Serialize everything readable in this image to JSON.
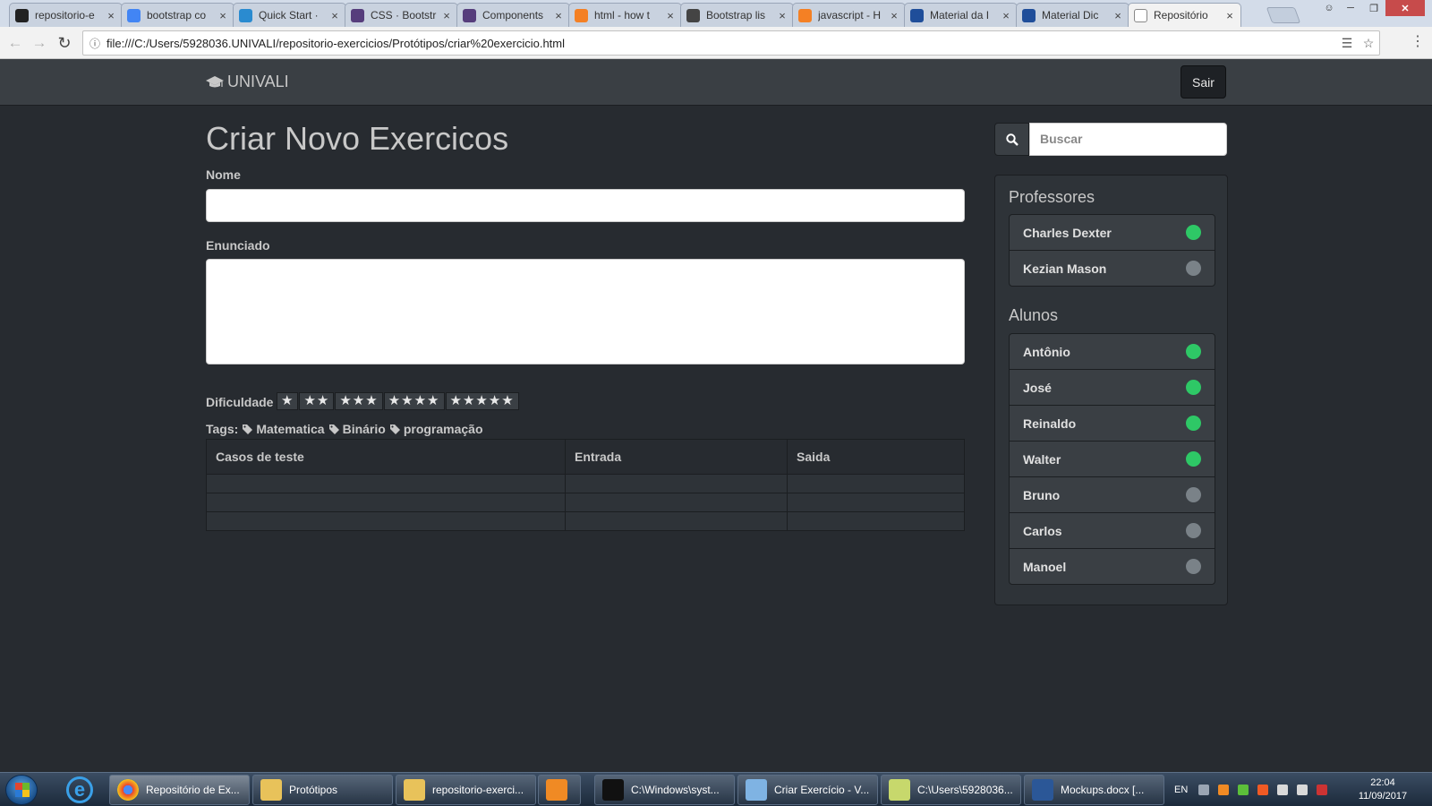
{
  "browser": {
    "tabs": [
      {
        "label": "repositorio-e",
        "icon": "github-icon",
        "color": "#222222"
      },
      {
        "label": "bootstrap co",
        "icon": "google-icon",
        "color": "#4285f4"
      },
      {
        "label": "Quick Start ·",
        "icon": "bootstrap-icon",
        "color": "#2a8bd0"
      },
      {
        "label": "CSS · Bootstr",
        "icon": "bootstrap-icon",
        "color": "#563d7c"
      },
      {
        "label": "Components",
        "icon": "bootstrap-icon",
        "color": "#563d7c"
      },
      {
        "label": "html - how t",
        "icon": "stackoverflow-icon",
        "color": "#f48024"
      },
      {
        "label": "Bootstrap lis",
        "icon": "bootstrap-icon",
        "color": "#444444"
      },
      {
        "label": "javascript - H",
        "icon": "stackoverflow-icon",
        "color": "#f48024"
      },
      {
        "label": "Material da I",
        "icon": "univali-icon",
        "color": "#1f4e9a"
      },
      {
        "label": "Material Dic",
        "icon": "univali-icon",
        "color": "#1f4e9a"
      },
      {
        "label": "Repositório",
        "icon": "page-icon",
        "color": "#ffffff"
      }
    ],
    "url": "file:///C:/Users/5928036.UNIVALI/repositorio-exercicios/Protótipos/criar%20exercicio.html"
  },
  "navbar": {
    "brand": "UNIVALI",
    "logout": "Sair"
  },
  "form": {
    "title": "Criar Novo Exercicos",
    "name_label": "Nome",
    "statement_label": "Enunciado",
    "difficulty_label": "Dificuldade",
    "difficulty_options": [
      "★",
      "★★",
      "★★★",
      "★★★★",
      "★★★★★"
    ],
    "tags_label": "Tags:",
    "tags": [
      "Matematica",
      "Binário",
      "programação"
    ],
    "table": {
      "headers": [
        "Casos de teste",
        "Entrada",
        "Saida"
      ],
      "rows": [
        [
          "",
          "",
          ""
        ],
        [
          "",
          "",
          ""
        ],
        [
          "",
          "",
          ""
        ]
      ]
    }
  },
  "sidebar": {
    "search_placeholder": "Buscar",
    "professors_title": "Professores",
    "professors": [
      {
        "name": "Charles Dexter",
        "online": true
      },
      {
        "name": "Kezian Mason",
        "online": false
      }
    ],
    "students_title": "Alunos",
    "students": [
      {
        "name": "Antônio",
        "online": true
      },
      {
        "name": "José",
        "online": true
      },
      {
        "name": "Reinaldo",
        "online": true
      },
      {
        "name": "Walter",
        "online": true
      },
      {
        "name": "Bruno",
        "online": false
      },
      {
        "name": "Carlos",
        "online": false
      },
      {
        "name": "Manoel",
        "online": false
      }
    ],
    "online_color": "#2ec866",
    "offline_color": "#7a8288"
  },
  "taskbar": {
    "items": [
      {
        "label": "Repositório de Ex...",
        "icon": "chrome-icon",
        "active": true
      },
      {
        "label": "Protótipos",
        "icon": "folder-icon",
        "active": false
      },
      {
        "label": "repositorio-exerci...",
        "icon": "folder-icon",
        "active": false
      },
      {
        "label": "",
        "icon": "media-player-icon",
        "active": false
      },
      {
        "label": "C:\\Windows\\syst...",
        "icon": "cmd-icon",
        "active": false
      },
      {
        "label": "Criar Exercício - V...",
        "icon": "image-viewer-icon",
        "active": false
      },
      {
        "label": "C:\\Users\\5928036...",
        "icon": "editor-icon",
        "active": false
      },
      {
        "label": "Mockups.docx [...",
        "icon": "word-icon",
        "active": false
      }
    ],
    "language": "EN",
    "time": "22:04",
    "date": "11/09/2017"
  }
}
